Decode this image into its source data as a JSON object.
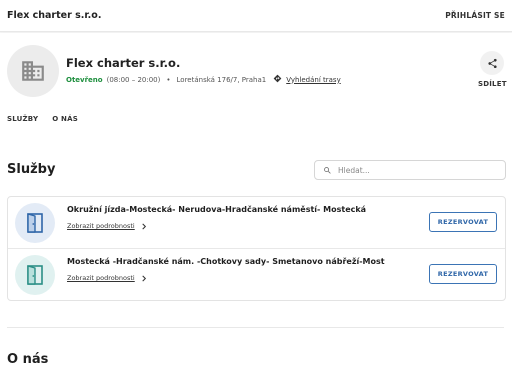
{
  "topbar": {
    "brand": "Flex charter s.r.o.",
    "login_label": "PŘIHLÁSIT SE"
  },
  "business": {
    "name": "Flex charter s.r.o.",
    "status": "Otevřeno",
    "hours": "(08:00 – 20:00)",
    "address": "Loretánská 176/7, Praha1",
    "route_label": "Vyhledání trasy",
    "share_label": "SDÍLET",
    "avatar_icon": "building-icon"
  },
  "tabs": [
    {
      "label": "SLUŽBY"
    },
    {
      "label": "O NÁS"
    }
  ],
  "services_section": {
    "title": "Služby",
    "search_placeholder": "Hledat...",
    "items": [
      {
        "name": "Okružní jízda-Mostecká- Nerudova-Hradčanské náměstí- Mostecká",
        "details_label": "Zobrazit podrobnosti",
        "reserve_label": "REZERVOVAT",
        "icon": "door-icon",
        "icon_bg": "#e3ebf6",
        "icon_color": "#2f66a8"
      },
      {
        "name": "Mostecká -Hradčanské nám. -Chotkovy sady- Smetanovo nábřeží-Most",
        "details_label": "Zobrazit podrobnosti",
        "reserve_label": "REZERVOVAT",
        "icon": "door-icon",
        "icon_bg": "#e0f1f0",
        "icon_color": "#2b8f86"
      }
    ]
  },
  "about_section": {
    "title": "O nás"
  },
  "colors": {
    "accent": "#2f66a8",
    "open_status": "#1e8f3e"
  }
}
